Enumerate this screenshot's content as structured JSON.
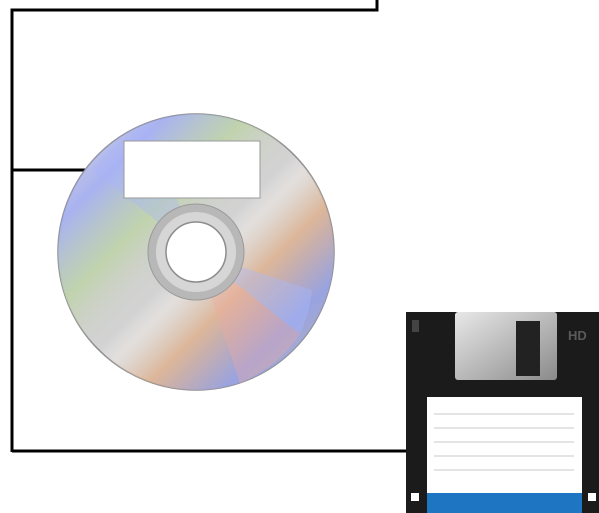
{
  "label_box": {
    "text": ""
  },
  "floppy": {
    "density_mark": "HD",
    "label_text": ""
  },
  "colors": {
    "line": "#000000",
    "label_fill": "#ffffff",
    "floppy_body": "#1b1b1b",
    "floppy_shutter": "#a7a7a7",
    "floppy_stripe": "#1e76c2",
    "floppy_rule": "#c8c8c8"
  },
  "icons": [
    "cd-disc-icon",
    "floppy-disk-icon",
    "arrow-right-icon"
  ]
}
